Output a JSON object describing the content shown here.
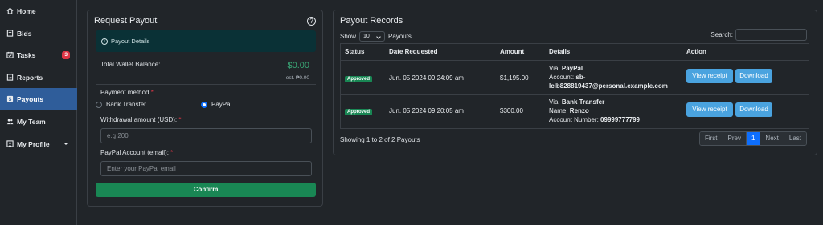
{
  "sidebar": {
    "items": [
      {
        "label": "Home",
        "icon": "home-icon"
      },
      {
        "label": "Bids",
        "icon": "bids-icon"
      },
      {
        "label": "Tasks",
        "icon": "tasks-icon",
        "badge": "3"
      },
      {
        "label": "Reports",
        "icon": "reports-icon"
      },
      {
        "label": "Payouts",
        "icon": "payouts-icon",
        "active": true
      },
      {
        "label": "My Team",
        "icon": "team-icon"
      },
      {
        "label": "My Profile",
        "icon": "profile-icon"
      }
    ]
  },
  "request": {
    "title": "Request Payout",
    "info": "Payout Details",
    "balance_label": "Total Wallet Balance:",
    "balance_value": "$0.00",
    "balance_est": "est. ₱0.00",
    "method_label": "Payment method",
    "method_required": "*",
    "options": [
      "Bank Transfer",
      "PayPal"
    ],
    "selected": "PayPal",
    "amount_label": "Withdrawal amount (USD):",
    "amount_required": "*",
    "amount_placeholder": "e.g 200",
    "email_label": "PayPal Account (email):",
    "email_required": "*",
    "email_placeholder": "Enter your PayPal email",
    "confirm": "Confirm"
  },
  "records": {
    "title": "Payout Records",
    "show_label": "Show",
    "show_value": "10",
    "show_suffix": "Payouts",
    "search_label": "Search:",
    "columns": [
      "Status",
      "Date Requested",
      "Amount",
      "Details",
      "Action"
    ],
    "rows": [
      {
        "status": "Approved",
        "date": "Jun. 05 2024 09:24:09 am",
        "amount": "$1,195.00",
        "details": [
          {
            "k": "Via:",
            "v": "PayPal"
          },
          {
            "k": "Account:",
            "v": "sb-"
          },
          {
            "k": "",
            "v": "lclb828819437@personal.example.com"
          }
        ],
        "view": "View receipt",
        "download": "Download"
      },
      {
        "status": "Approved",
        "date": "Jun. 05 2024 09:20:05 am",
        "amount": "$300.00",
        "details": [
          {
            "k": "Via:",
            "v": "Bank Transfer"
          },
          {
            "k": "Name:",
            "v": "Renzo"
          },
          {
            "k": "Account Number:",
            "v": "09999777799"
          }
        ],
        "view": "View receipt",
        "download": "Download"
      }
    ],
    "showing": "Showing 1 to 2 of 2 Payouts",
    "pager": [
      "First",
      "Prev",
      "1",
      "Next",
      "Last"
    ],
    "current_page": "1"
  }
}
